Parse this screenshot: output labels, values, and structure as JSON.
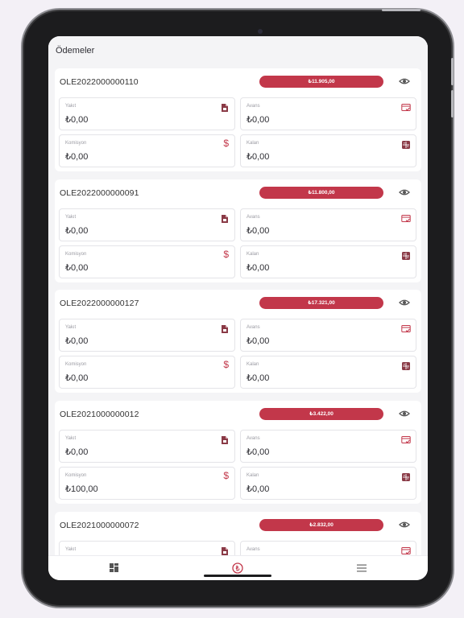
{
  "header": {
    "title": "Ödemeler"
  },
  "labels": {
    "yakit": "Yakıt",
    "avans": "Avans",
    "komisyon": "Komisyon",
    "kalan": "Kalan"
  },
  "accent_color": "#c2374a",
  "payments": [
    {
      "id": "OLE2022000000110",
      "amount": "₺11.905,00",
      "yakit": "₺0,00",
      "avans": "₺0,00",
      "komisyon": "₺0,00",
      "kalan": "₺0,00"
    },
    {
      "id": "OLE2022000000091",
      "amount": "₺11.800,00",
      "yakit": "₺0,00",
      "avans": "₺0,00",
      "komisyon": "₺0,00",
      "kalan": "₺0,00"
    },
    {
      "id": "OLE2022000000127",
      "amount": "₺17.321,00",
      "yakit": "₺0,00",
      "avans": "₺0,00",
      "komisyon": "₺0,00",
      "kalan": "₺0,00"
    },
    {
      "id": "OLE2021000000012",
      "amount": "₺3.422,00",
      "yakit": "₺0,00",
      "avans": "₺0,00",
      "komisyon": "₺100,00",
      "kalan": "₺0,00"
    },
    {
      "id": "OLE2021000000072",
      "amount": "₺2.832,00",
      "yakit": "",
      "avans": "",
      "komisyon": "",
      "kalan": ""
    }
  ],
  "tabbar": {
    "items": [
      "dashboard-icon",
      "lira-icon",
      "menu-icon"
    ],
    "active_index": 1
  }
}
